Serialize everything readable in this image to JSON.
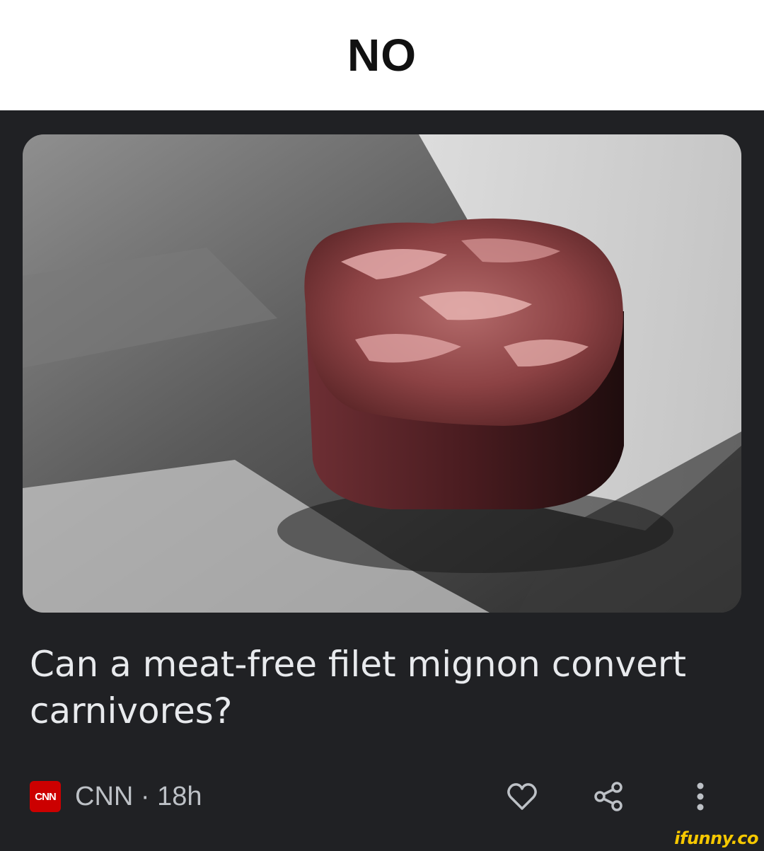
{
  "caption": {
    "text": "NO"
  },
  "article": {
    "image_description_icon": "steak-photo",
    "headline": "Can a meat-free filet mignon convert carnivores?",
    "source": {
      "logo_text": "CNN",
      "meta_text": "CNN · 18h"
    },
    "actions": {
      "like_icon": "heart-icon",
      "share_icon": "share-icon",
      "more_icon": "more-vertical-icon"
    }
  },
  "watermark": {
    "text": "ifunny.co"
  },
  "colors": {
    "caption_bg": "#ffffff",
    "card_bg": "#202124",
    "headline": "#e8eaed",
    "meta": "#bdc1c6",
    "cnn_red": "#cc0000",
    "watermark": "#f6c800"
  }
}
